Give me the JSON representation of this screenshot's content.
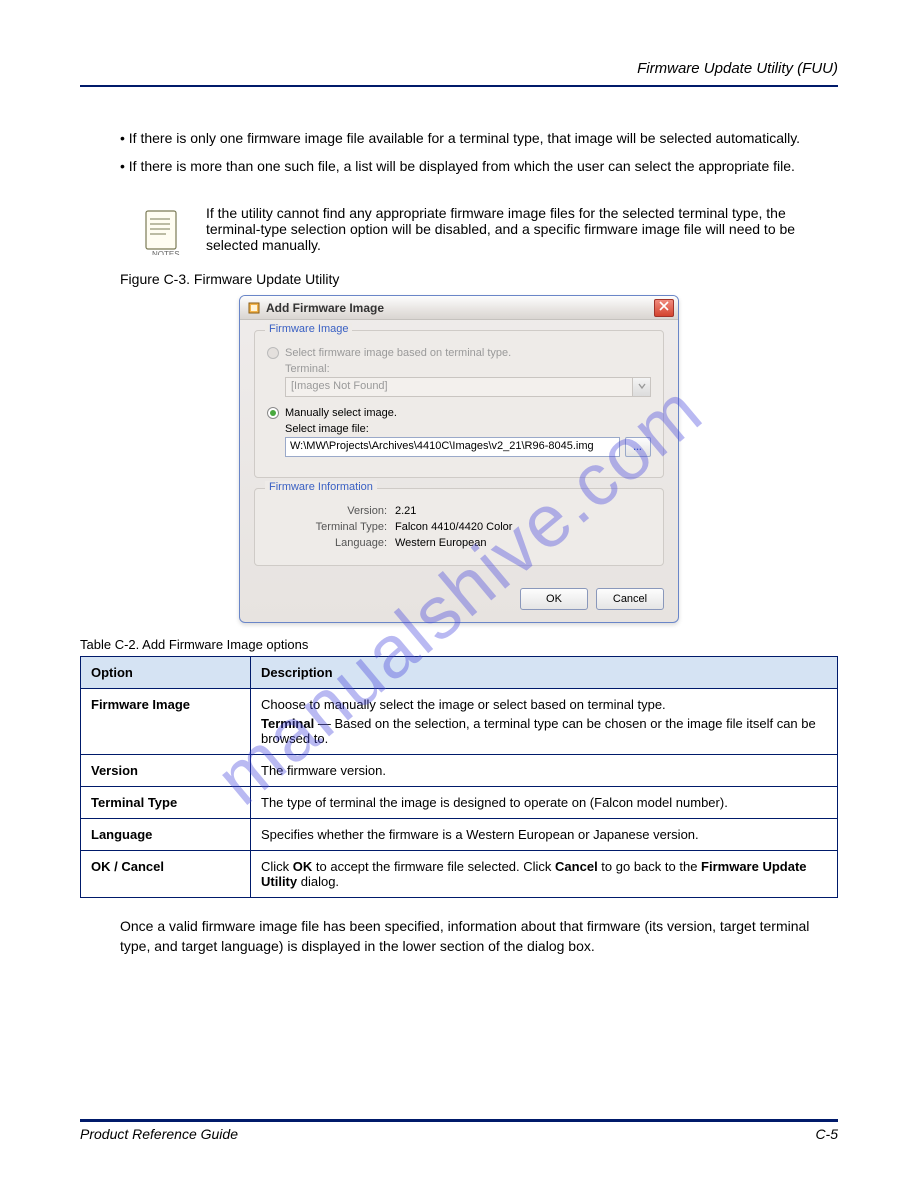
{
  "header": {
    "title": "Firmware Update Utility (FUU)"
  },
  "intro": {
    "p1": "• If there is only one firmware image file available for a terminal type, that image will be selected automatically.",
    "p2": "• If there is more than one such file, a list will be displayed from which the user can select the appropriate file."
  },
  "note": {
    "text": "If the utility cannot find any appropriate firmware image files for the selected terminal type, the terminal-type selection option will be disabled, and a specific firmware image file will need to be selected manually."
  },
  "figure_label": "Figure C-3. Firmware Update Utility",
  "dialog": {
    "title": "Add Firmware Image",
    "group_image": {
      "legend": "Firmware Image",
      "opt_terminal": "Select firmware image based on terminal type.",
      "terminal_label": "Terminal:",
      "terminal_value": "[Images Not Found]",
      "opt_manual": "Manually select image.",
      "select_file_label": "Select image file:",
      "file_value": "W:\\MW\\Projects\\Archives\\4410C\\Images\\v2_21\\R96-8045.img"
    },
    "group_info": {
      "legend": "Firmware Information",
      "version_label": "Version:",
      "version_value": "2.21",
      "terminal_label": "Terminal Type:",
      "terminal_value": "Falcon 4410/4420 Color",
      "language_label": "Language:",
      "language_value": "Western European"
    },
    "buttons": {
      "ok": "OK",
      "cancel": "Cancel"
    }
  },
  "table": {
    "caption": "Table C-2. Add Firmware Image options",
    "headers": [
      "Option",
      "Description"
    ],
    "rows": [
      {
        "option": "Firmware Image",
        "desc_main": "Choose to manually select the image or select based on terminal type.",
        "sub_label": "Terminal",
        "sub_desc": " — Based on the selection, a terminal type can be chosen or the image file itself can be browsed to."
      },
      {
        "option": "Version",
        "desc_main": "The firmware version.",
        "sub_label": "",
        "sub_desc": ""
      },
      {
        "option": "Terminal Type",
        "desc_main": "The type of terminal the image is designed to operate on (Falcon model number).",
        "sub_label": "",
        "sub_desc": ""
      },
      {
        "option": "Language",
        "desc_main": "Specifies whether the firmware is a Western European or Japanese version.",
        "sub_label": "",
        "sub_desc": ""
      },
      {
        "option": "OK / Cancel",
        "desc_main": "Click **OK** to accept the firmware file selected. Click **Cancel** to go back to the **Firmware Update Utility** dialog.",
        "sub_label": "",
        "sub_desc": ""
      }
    ]
  },
  "post": {
    "text": "Once a valid firmware image file has been specified, information about that firmware (its version, target terminal type, and target language) is displayed in the lower section of the dialog box."
  },
  "footer": {
    "left": "Product Reference Guide",
    "right": "C-5"
  },
  "watermark": "manualshive.com"
}
